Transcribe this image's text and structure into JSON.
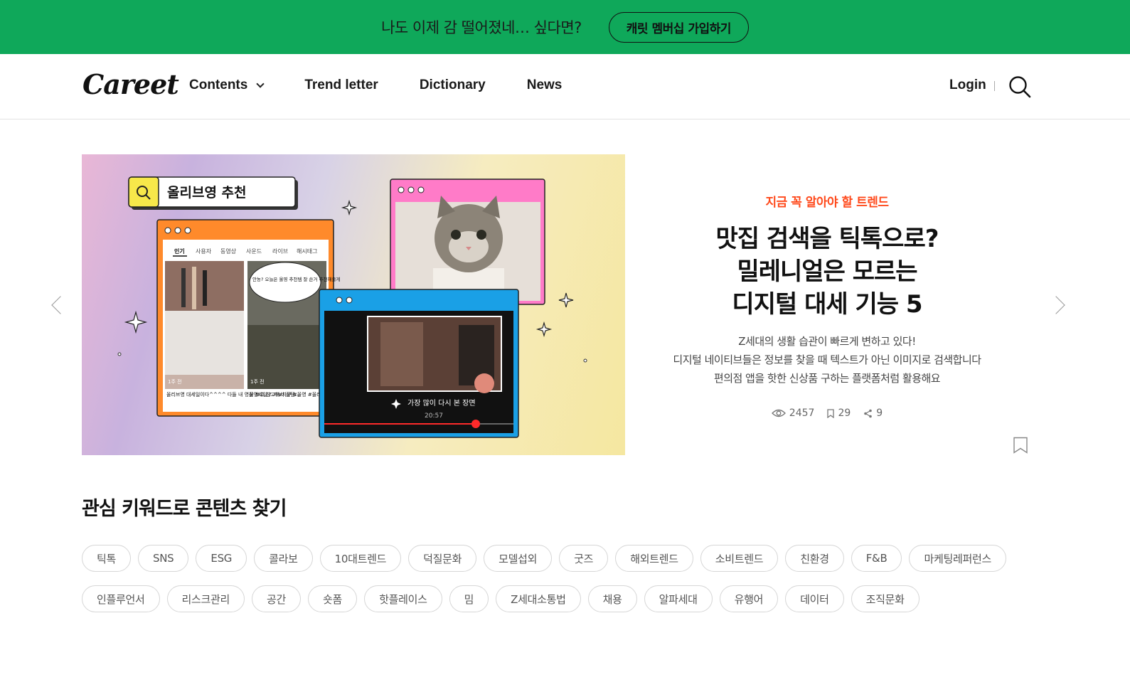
{
  "promo": {
    "text": "나도 이제 감 떨어졌네… 싶다면?",
    "button": "캐릿 멤버십 가입하기"
  },
  "header": {
    "logo": "Careet",
    "nav": [
      "Contents",
      "Trend letter",
      "Dictionary",
      "News"
    ],
    "login": "Login"
  },
  "hero": {
    "kicker": "지금 꼭 알아야 할 트렌드",
    "headline": [
      "맛집 검색을 틱톡으로?",
      "밀레니얼은 모르는",
      "디지털 대세 기능 5"
    ],
    "description": [
      "Z세대의 생활 습관이 빠르게 변하고 있다!",
      "디지털 네이티브들은 정보를 찾을 때 텍스트가 아닌 이미지로 검색합니다",
      "편의점 앱을 핫한 신상품 구하는 플랫폼처럼 활용해요"
    ],
    "views": "2457",
    "bookmarks": "29",
    "shares": "9",
    "image": {
      "search_text": "올리브영 추천",
      "tabs": [
        "인기",
        "사용자",
        "동영상",
        "사운드",
        "라이브",
        "해시태그"
      ],
      "card1_caption": "올리브영 대세일이다^^^^ 다들 내 영상 보고 참고해서 꿀템...",
      "card2_caption": "올영세일 ? 가보자구 #올영 #올리브영 #올영세일...",
      "card2_bubble": "안뇽? 오늘은 올영 추천템 잘 쓴거 추천해줄게",
      "card_time": "1주 전",
      "video_label": "가장 많이 다시 본 장면",
      "video_time": "20:57"
    }
  },
  "keywords": {
    "title": "관심 키워드로 콘텐츠 찾기",
    "chips": [
      "틱톡",
      "SNS",
      "ESG",
      "콜라보",
      "10대트렌드",
      "덕질문화",
      "모델섭외",
      "굿즈",
      "해외트렌드",
      "소비트렌드",
      "친환경",
      "F&B",
      "마케팅레퍼런스",
      "인플루언서",
      "리스크관리",
      "공간",
      "숏폼",
      "핫플레이스",
      "밈",
      "Z세대소통법",
      "채용",
      "알파세대",
      "유행어",
      "데이터",
      "조직문화"
    ]
  },
  "colors": {
    "promo_bg": "#0fa85a",
    "kicker": "#ff4a1c"
  }
}
